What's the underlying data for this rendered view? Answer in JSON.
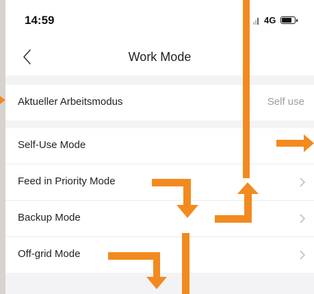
{
  "status_bar": {
    "time": "14:59",
    "network": "4G"
  },
  "header": {
    "title": "Work Mode"
  },
  "current_mode": {
    "label": "Aktueller Arbeitsmodus",
    "value": "Self use"
  },
  "modes": [
    {
      "label": "Self-Use Mode"
    },
    {
      "label": "Feed in Priority Mode"
    },
    {
      "label": "Backup Mode"
    },
    {
      "label": "Off-grid Mode"
    }
  ],
  "colors": {
    "accent_arrow": "#f28a1f",
    "background": "#f3f3f5",
    "secondary_text": "#9b9b9b"
  },
  "icons": {
    "back": "chevron-left-icon",
    "row": "chevron-right-icon",
    "battery": "battery-icon",
    "signal": "signal-icon"
  }
}
